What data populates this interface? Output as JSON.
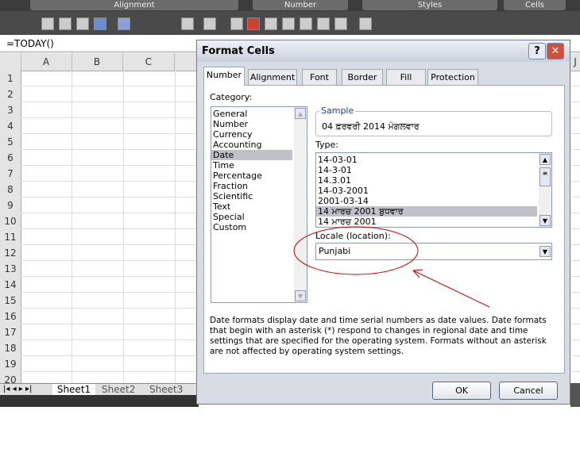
{
  "ribbon": {
    "groups": [
      "Alignment",
      "Number",
      "Styles",
      "Cells"
    ]
  },
  "formula_bar": {
    "value": "=TODAY()"
  },
  "sheet": {
    "columns": [
      "A",
      "B",
      "C"
    ],
    "rows": [
      "1",
      "2",
      "3",
      "4",
      "5",
      "6",
      "7",
      "8",
      "9",
      "10",
      "11",
      "12",
      "13",
      "14",
      "15",
      "16",
      "17",
      "18",
      "19",
      "20"
    ],
    "right_col": "J"
  },
  "sheet_tabs": [
    "Sheet1",
    "Sheet2",
    "Sheet3"
  ],
  "dialog": {
    "title": "Format Cells",
    "help": "?",
    "close": "✕",
    "tabs": [
      "Number",
      "Alignment",
      "Font",
      "Border",
      "Fill",
      "Protection"
    ],
    "category_label": "Category:",
    "categories": [
      "General",
      "Number",
      "Currency",
      "Accounting",
      "Date",
      "Time",
      "Percentage",
      "Fraction",
      "Scientific",
      "Text",
      "Special",
      "Custom"
    ],
    "selected_category": "Date",
    "sample_label": "Sample",
    "sample_value": "04 ਫ਼ਰਵਰੀ 2014 ਮੰਗਲਵਾਰ",
    "type_label": "Type:",
    "types": [
      "14-03-01",
      "14-3-01",
      "14.3.01",
      "14-03-2001",
      "2001-03-14",
      "14 ਮਾਰਚ 2001 ਬੁਧਵਾਰ",
      "14 ਮਾਰਚ 2001"
    ],
    "selected_type": "14 ਮਾਰਚ 2001 ਬੁਧਵਾਰ",
    "locale_label": "Locale (location):",
    "locale_value": "Punjabi",
    "description": "Date formats display date and time serial numbers as date values.  Date formats that begin with an asterisk (*) respond to changes in regional date and time settings that are specified for the operating system. Formats without an asterisk are not affected by operating system settings.",
    "ok": "OK",
    "cancel": "Cancel"
  },
  "annotation_color": "#c00000"
}
